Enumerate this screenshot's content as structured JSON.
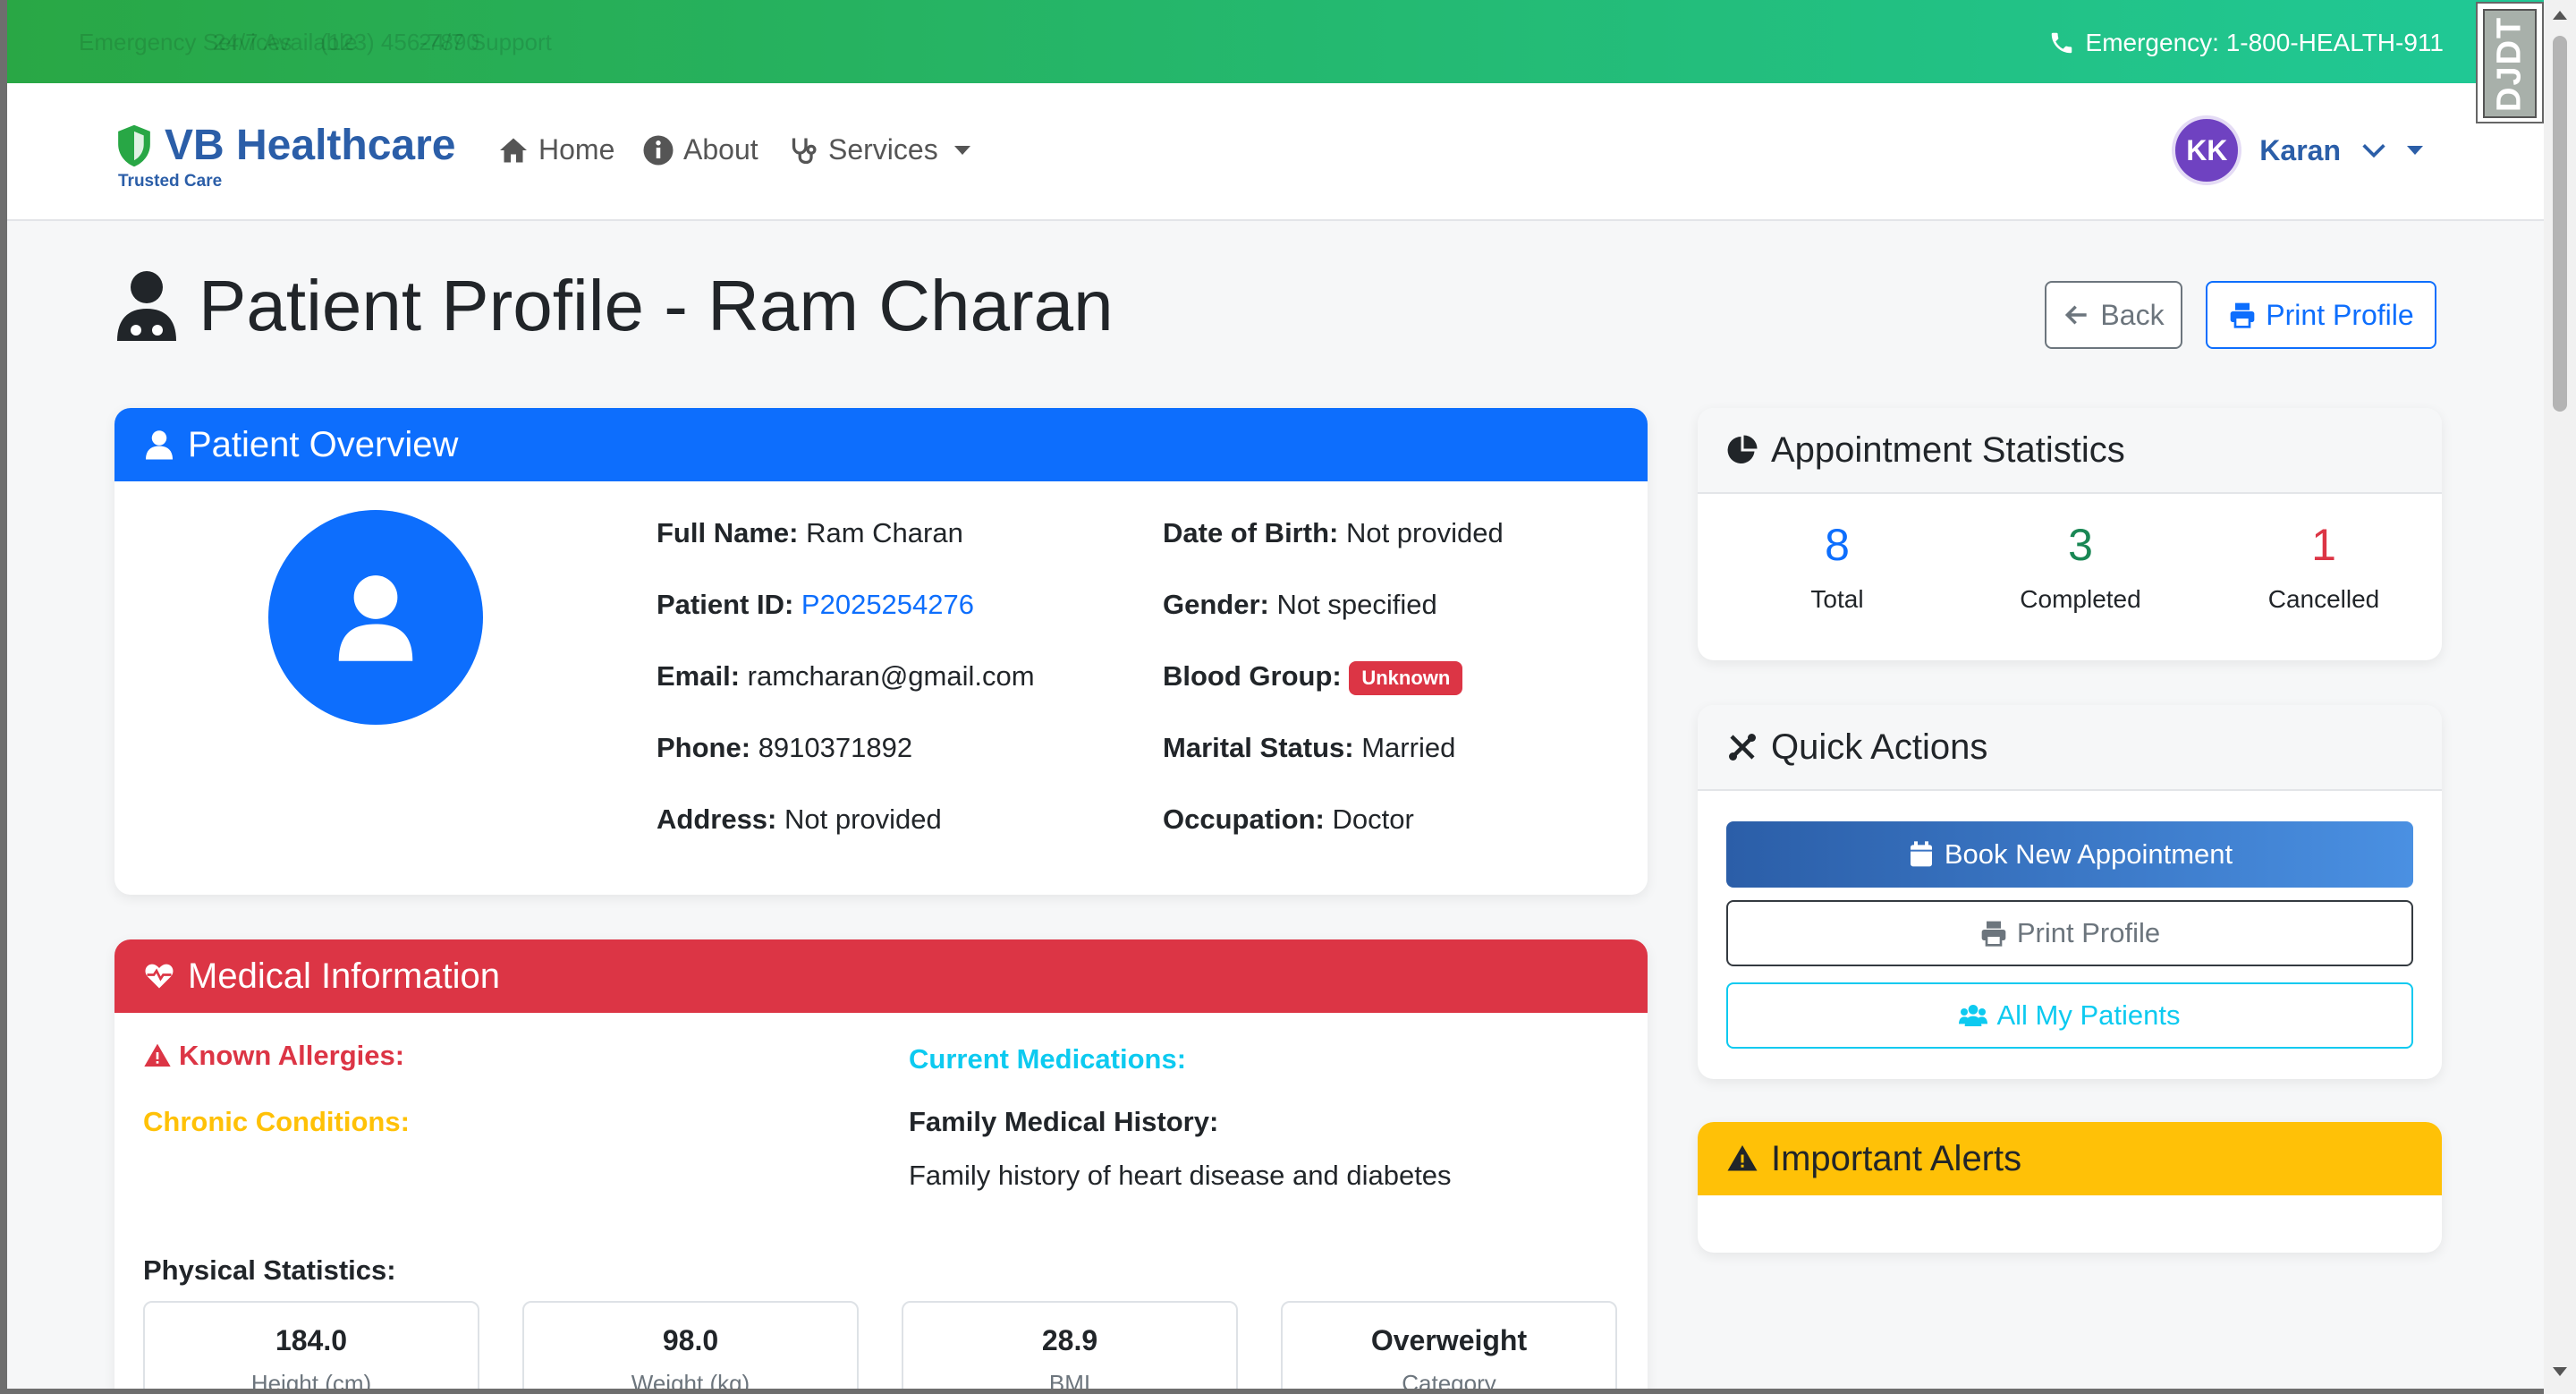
{
  "topbar": {
    "faint_items": [
      "Emergency Services",
      "24/7 Available",
      "(123) 456-7890",
      "24/7 Support"
    ],
    "emergency": "Emergency: 1-800-HEALTH-911",
    "extension_label": "DJDT"
  },
  "navbar": {
    "brand_name": "VB Healthcare",
    "brand_tagline": "Trusted Care",
    "items": [
      {
        "label": "Home",
        "icon": "home-icon"
      },
      {
        "label": "About",
        "icon": "info-icon"
      },
      {
        "label": "Services",
        "icon": "stethoscope-icon"
      }
    ],
    "user_initials": "KK",
    "user_name": "Karan"
  },
  "page": {
    "title": "Patient Profile - Ram Charan",
    "back_label": "Back",
    "print_label": "Print Profile"
  },
  "overview": {
    "title": "Patient Overview",
    "full_name_label": "Full Name:",
    "full_name": "Ram Charan",
    "patient_id_label": "Patient ID:",
    "patient_id": "P2025254276",
    "email_label": "Email:",
    "email": "ramcharan@gmail.com",
    "phone_label": "Phone:",
    "phone": "8910371892",
    "address_label": "Address:",
    "address": "Not provided",
    "dob_label": "Date of Birth:",
    "dob": "Not provided",
    "gender_label": "Gender:",
    "gender": "Not specified",
    "blood_label": "Blood Group:",
    "blood": "Unknown",
    "marital_label": "Marital Status:",
    "marital": "Married",
    "occupation_label": "Occupation:",
    "occupation": "Doctor"
  },
  "medical": {
    "title": "Medical Information",
    "allergies_label": "Known Allergies:",
    "medications_label": "Current Medications:",
    "chronic_label": "Chronic Conditions:",
    "family_label": "Family Medical History:",
    "family_value": "Family history of heart disease and diabetes",
    "physical_label": "Physical Statistics:",
    "stats": [
      {
        "value": "184.0",
        "label": "Height (cm)"
      },
      {
        "value": "98.0",
        "label": "Weight (kg)"
      },
      {
        "value": "28.9",
        "label": "BMI"
      },
      {
        "value": "Overweight",
        "label": "Category"
      }
    ]
  },
  "appointments": {
    "title": "Appointment Statistics",
    "total": "8",
    "total_label": "Total",
    "completed": "3",
    "completed_label": "Completed",
    "cancelled": "1",
    "cancelled_label": "Cancelled"
  },
  "quick_actions": {
    "title": "Quick Actions",
    "book": "Book New Appointment",
    "print": "Print Profile",
    "patients": "All My Patients"
  },
  "alerts": {
    "title": "Important Alerts"
  },
  "colors": {
    "primary": "#0d6efd",
    "danger": "#dc3545",
    "success": "#198754",
    "warning": "#ffc107",
    "info": "#0dcaf0",
    "brand": "#2b5ea8"
  }
}
